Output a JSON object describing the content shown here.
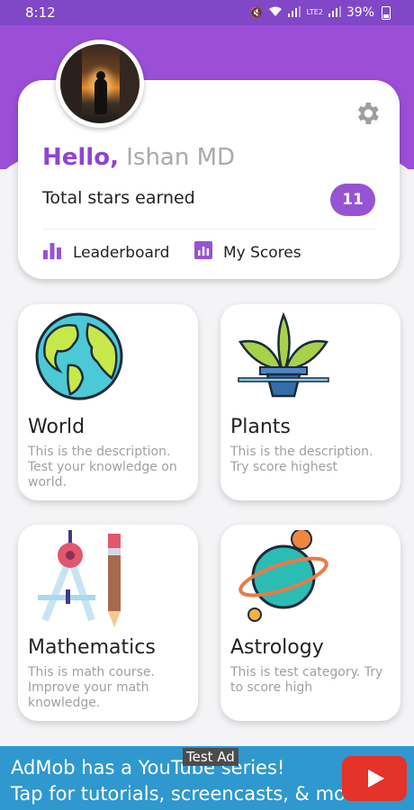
{
  "status_bar": {
    "time": "8:12",
    "battery": "39%",
    "network": "LTE2"
  },
  "profile": {
    "hello": "Hello,",
    "name": "Ishan MD",
    "stars_label": "Total stars earned",
    "stars_count": "11",
    "leaderboard_label": "Leaderboard",
    "my_scores_label": "My Scores"
  },
  "categories": [
    {
      "title": "World",
      "description": "This is the description. Test your knowledge on world.",
      "icon": "globe-icon"
    },
    {
      "title": "Plants",
      "description": "This is the description. Try score highest",
      "icon": "plant-icon"
    },
    {
      "title": "Mathematics",
      "description": "This is math course. Improve your math knowledge.",
      "icon": "compass-pencil-icon"
    },
    {
      "title": "Astrology",
      "description": "This is test category. Try to score high",
      "icon": "planet-icon"
    }
  ],
  "ad": {
    "tag": "Test Ad",
    "line1": "AdMob has a YouTube series!",
    "line2": "Tap for tutorials, screencasts, & more."
  },
  "colors": {
    "accent": "#9653d4",
    "header": "#9b4ed8",
    "ad_bg": "#2e98cf"
  }
}
